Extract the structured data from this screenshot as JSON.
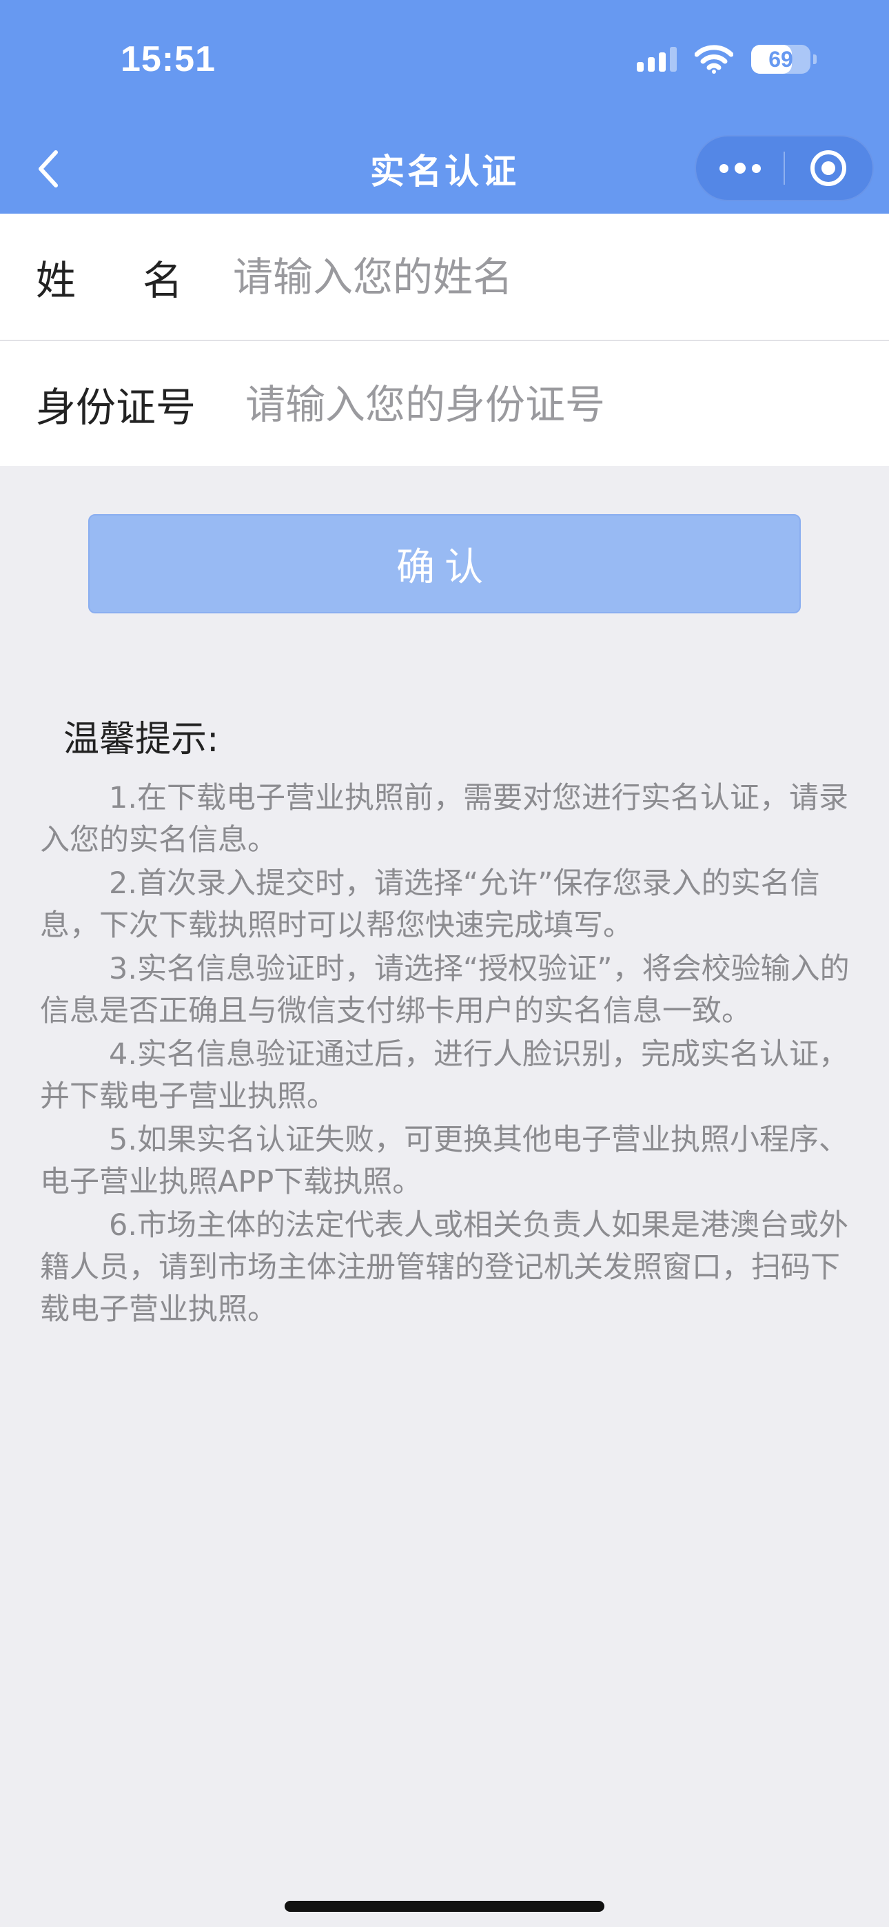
{
  "status_bar": {
    "time": "15:51",
    "battery": "69",
    "battery_fraction": 0.69,
    "icons": [
      "signal-icon",
      "wifi-icon",
      "battery-icon"
    ]
  },
  "nav": {
    "title": "实名认证",
    "back_icon": "chevron-left-icon",
    "more_icon": "more-dots-icon",
    "close_icon": "target-close-icon"
  },
  "form": {
    "name": {
      "label": "姓名",
      "placeholder": "请输入您的姓名",
      "value": ""
    },
    "id": {
      "label": "身份证号",
      "placeholder": "请输入您的身份证号",
      "value": ""
    }
  },
  "confirm_label": "确认",
  "tips": {
    "title": "温馨提示:",
    "items": [
      "1.在下载电子营业执照前，需要对您进行实名认证，请录入您的实名信息。",
      "2.首次录入提交时，请选择“允许”保存您录入的实名信息，下次下载执照时可以帮您快速完成填写。",
      "3.实名信息验证时，请选择“授权验证”，将会校验输入的信息是否正确且与微信支付绑卡用户的实名信息一致。",
      "4.实名信息验证通过后，进行人脸识别，完成实名认证，并下载电子营业执照。",
      "5.如果实名认证失败，可更换其他电子营业执照小程序、电子营业执照APP下载执照。",
      "6.市场主体的法定代表人或相关负责人如果是港澳台或外籍人员，请到市场主体注册管辖的登记机关发照窗口，扫码下载电子营业执照。"
    ]
  },
  "colors": {
    "header": "#6799f1",
    "button": "#98baf3",
    "background": "#eeeef2"
  }
}
